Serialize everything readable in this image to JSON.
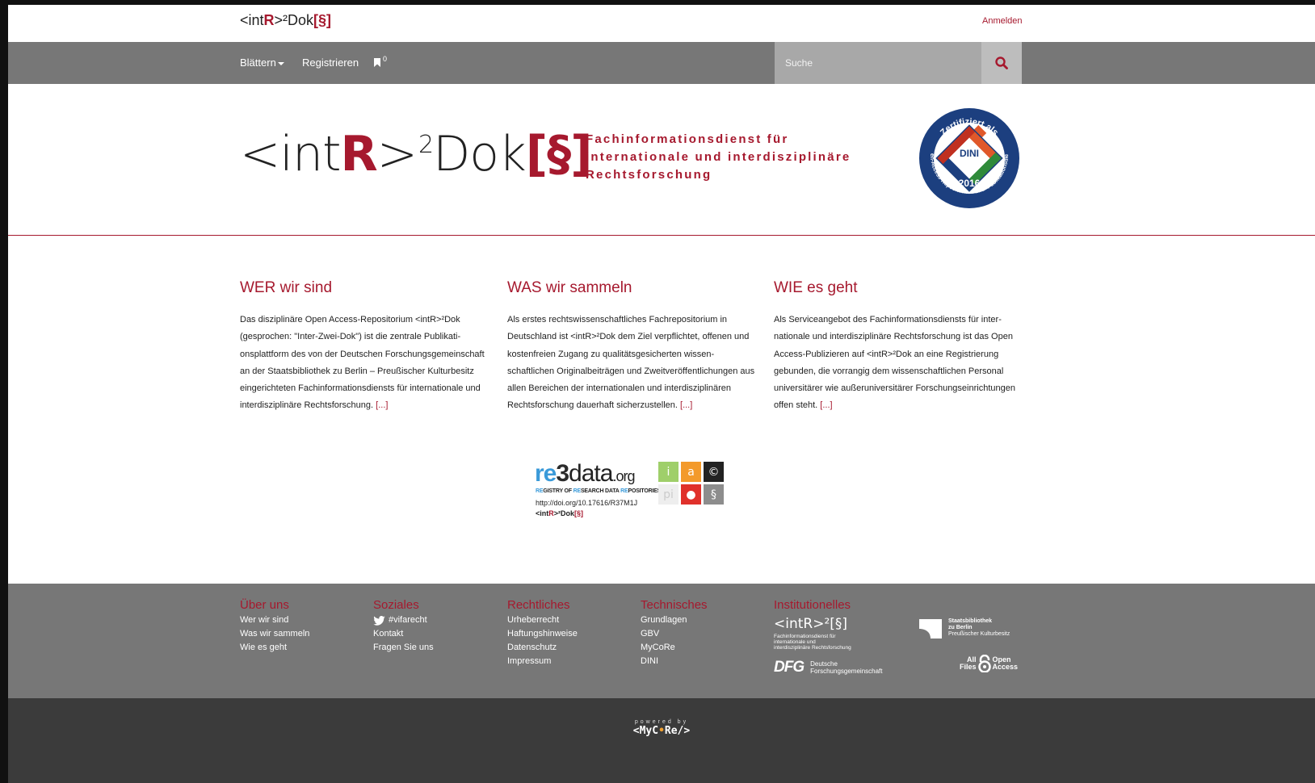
{
  "topbar": {
    "logo": {
      "pre": "<int",
      "r": "R",
      "post": ">²Dok",
      "para": "[§]"
    },
    "login": "Anmelden"
  },
  "nav": {
    "browse": "Blättern",
    "register": "Registrieren",
    "bookmark_count": "0",
    "search_placeholder": "Suche"
  },
  "hero": {
    "logo": {
      "pre": "<int",
      "r": "R",
      "mid": ">",
      "sup": "2",
      "post": "Dok",
      "para": "[§]"
    },
    "tagline": [
      "Fachinformationsdienst für",
      "internationale und interdisziplinäre",
      "Rechtsforschung"
    ],
    "badge": {
      "top": "Zertifiziert als",
      "center": "DINI",
      "year": "2016",
      "ring": "Open-Access-Repositorium und -Publikationsdienst"
    }
  },
  "columns": [
    {
      "title": "WER wir sind",
      "text": "Das disziplinäre Open Access-Repositorium <intR>²Dok (gesprochen: \"Inter-Zwei-Dok\") ist die zentrale Publikati­onsplattform des von der Deutschen Forschungsgemein­schaft an der Staatsbibliothek zu Berlin – Preußischer Kul­turbesitz eingerichteten Fachinformationsdiensts für inter­nationale und interdisziplinäre Rechtsforschung.",
      "more": "[...]"
    },
    {
      "title": "WAS wir sammeln",
      "text": "Als erstes rechtswissenschaftliches Fachrepositorium in Deutschland ist <intR>²Dok dem Ziel verpflichtet, offenen und kostenfreien Zugang zu qualitätsgesicherten wissen­schaftlichen Originalbeiträgen und Zweitveröffentlichun­gen aus allen Bereichen der internationalen und interdiszi­plinären Rechtsforschung dauerhaft sicherzustellen.",
      "more": "[...]"
    },
    {
      "title": "WIE es geht",
      "text": "Als Serviceangebot des Fachinformationsdiensts für inter­nationale und interdisziplinäre Rechtsforschung ist das Open Access-Publizieren auf <intR>²Dok an eine Registrie­rung gebunden, die vorrangig dem wissenschaftlichen Per­sonal universitärer wie außeruniversitärer Forschungsein­richtungen offen steht.",
      "more": "[...]"
    }
  ],
  "re3data": {
    "re": "re",
    "three": "3",
    "data": "data",
    "org": ".org",
    "sub_parts": [
      "RE",
      "GISTRY OF ",
      "RE",
      "SEARCH DATA ",
      "RE",
      "POSITORIES"
    ],
    "doi": "http://doi.org/10.17616/R37M1J",
    "name_pre": "<int",
    "name_r": "R",
    "name_post": ">²Dok",
    "name_para": "[§]",
    "tiles": [
      "i",
      "a",
      "©",
      "pi",
      "●",
      "§"
    ],
    "tile_colors": [
      "#9fcf6a",
      "#f39a2b",
      "#222222",
      "#eeeeee",
      "#e0312b",
      "#8d8d8d"
    ]
  },
  "footer": {
    "about": {
      "title": "Über uns",
      "links": [
        "Wer wir sind",
        "Was wir sammeln",
        "Wie es geht"
      ]
    },
    "social": {
      "title": "Soziales",
      "links": [
        "#vifarecht",
        "Kontakt",
        "Fragen Sie uns"
      ]
    },
    "legal": {
      "title": "Rechtliches",
      "links": [
        "Urheberrecht",
        "Haftungshinweise",
        "Datenschutz",
        "Impressum"
      ]
    },
    "tech": {
      "title": "Technisches",
      "links": [
        "Grundlagen",
        "GBV",
        "MyCoRe",
        "DINI"
      ]
    },
    "inst": {
      "title": "Institutionelles",
      "intr_logo": "<intR>²[§]",
      "intr_sub": [
        "Fachinformationsdienst für",
        "internationale und",
        "interdisziplinäre Rechtsforschung"
      ],
      "dfg": "DFG",
      "dfg_sub": [
        "Deutsche",
        "Forschungsgemeinschaft"
      ],
      "sbb": [
        "Staatsbibliothek",
        "zu Berlin",
        "Preußischer Kulturbesitz"
      ],
      "aof": [
        "All",
        "Files",
        "Open",
        "Access"
      ]
    }
  },
  "bottom": {
    "powered": "powered by",
    "mycore_pre": "<MyC",
    "mycore_dot": "•",
    "mycore_post": "Re/>"
  },
  "colors": {
    "accent": "#a6192e",
    "nav": "#777777",
    "footer_dark": "#3b3b3b"
  }
}
